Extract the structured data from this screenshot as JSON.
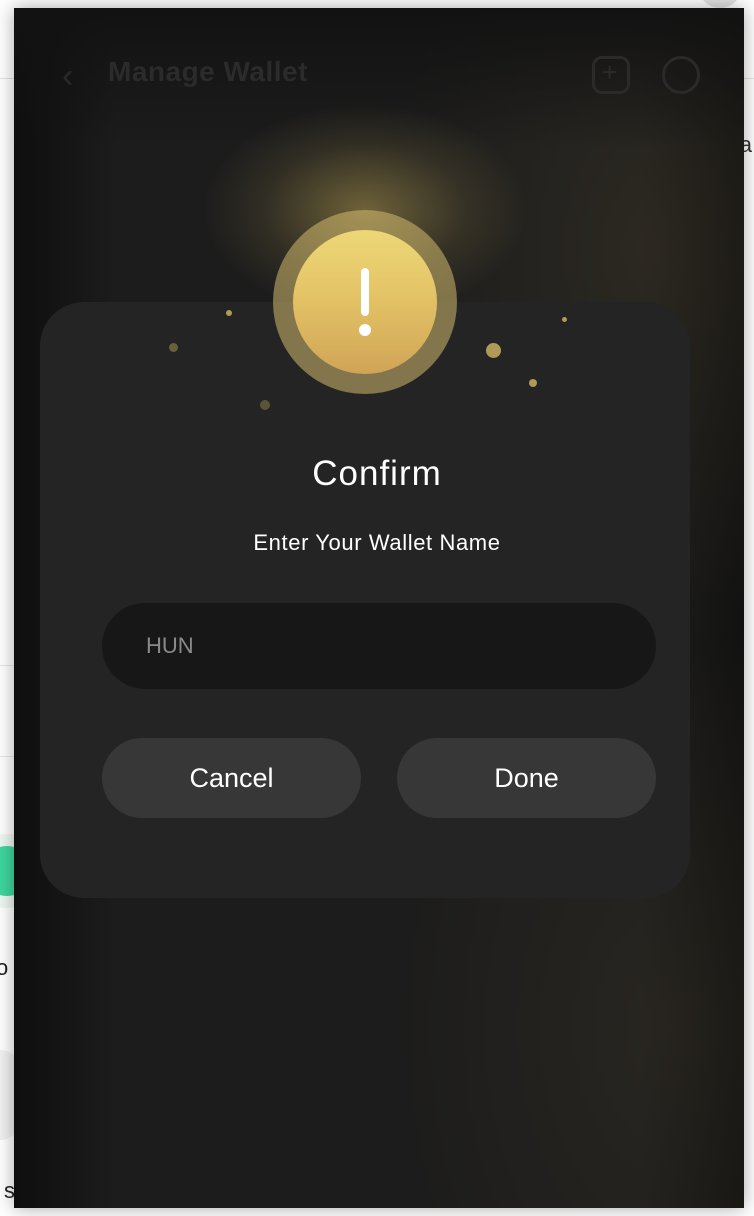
{
  "background": {
    "header": {
      "back_icon": "chevron-left-icon",
      "title": "Manage Wallet",
      "add_icon": "add-wallet-icon",
      "restore_icon": "restore-icon"
    },
    "right_edge_text": "a",
    "left_edge_text_1": "o",
    "left_edge_text_2": "s"
  },
  "dialog": {
    "icon": "exclamation-icon",
    "accent_color": "#e4c466",
    "title": "Confirm",
    "subtitle": "Enter Your Wallet Name",
    "input": {
      "value": "",
      "placeholder": "HUN"
    },
    "buttons": {
      "cancel_label": "Cancel",
      "done_label": "Done"
    }
  }
}
